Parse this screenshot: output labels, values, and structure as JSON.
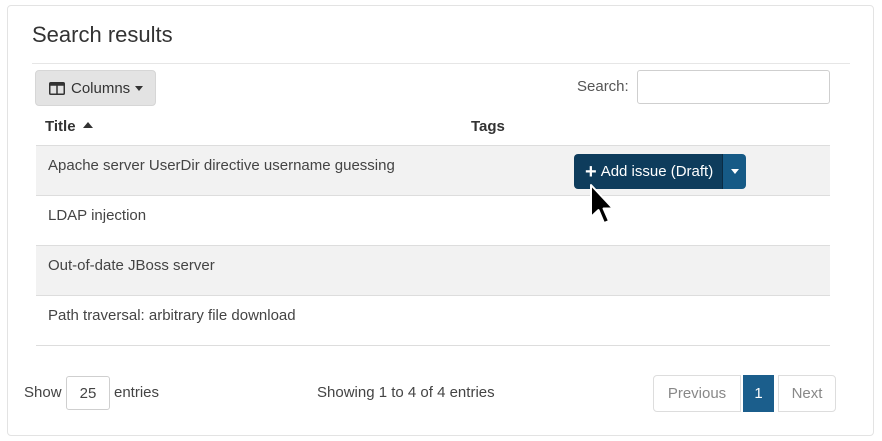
{
  "panel": {
    "title": "Search results"
  },
  "toolbar": {
    "columns_label": "Columns",
    "search_label": "Search:",
    "search_value": ""
  },
  "table": {
    "headers": [
      "Title",
      "Tags"
    ],
    "sort_column": "Title",
    "sort_direction": "ascending",
    "rows": [
      {
        "title": "Apache server UserDir directive username guessing",
        "tags": ""
      },
      {
        "title": "LDAP injection",
        "tags": ""
      },
      {
        "title": "Out-of-date JBoss server",
        "tags": ""
      },
      {
        "title": "Path traversal: arbitrary file download",
        "tags": ""
      }
    ],
    "row_action": {
      "label": "Add issue (Draft)",
      "icon": "plus-icon"
    }
  },
  "footer": {
    "show_label": "Show",
    "page_length": "25",
    "entries_label": "entries",
    "info": "Showing 1 to 4 of 4 entries",
    "pagination": {
      "previous": "Previous",
      "current": "1",
      "next": "Next"
    }
  },
  "colors": {
    "primary_dark": "#0e3c5c",
    "primary": "#1b5e8c",
    "stripe": "#f2f2f2"
  }
}
